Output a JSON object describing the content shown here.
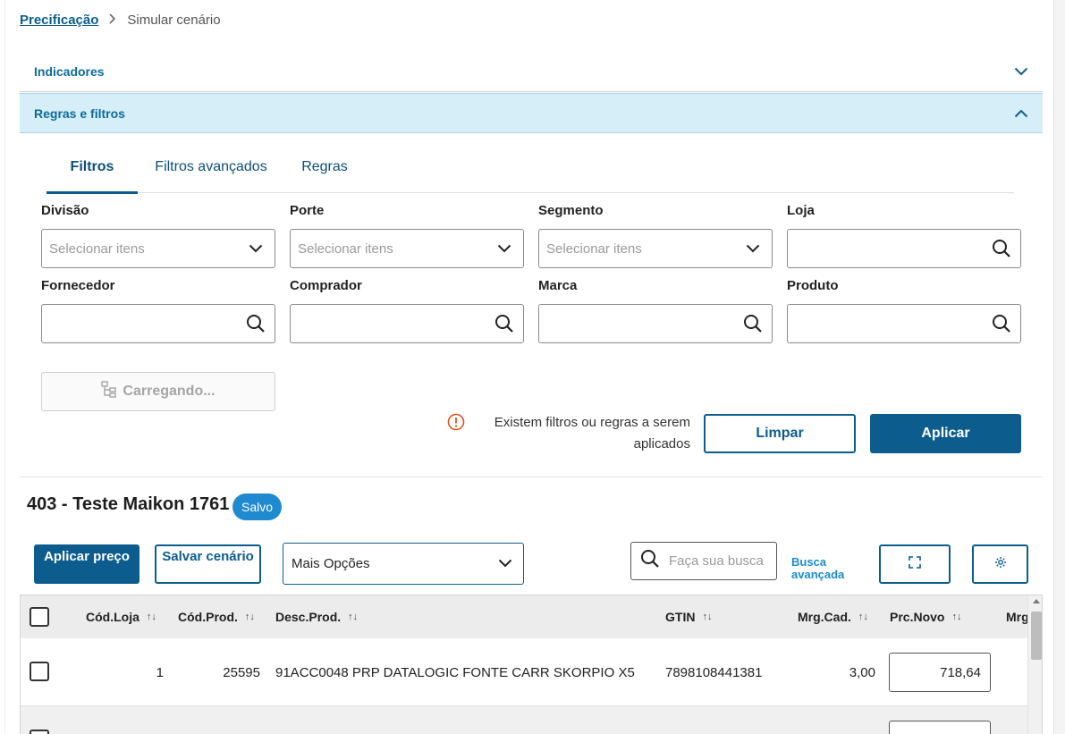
{
  "breadcrumb": {
    "root": "Precificação",
    "current": "Simular cenário"
  },
  "accordions": {
    "indicators": "Indicadores",
    "rules_filters": "Regras e filtros"
  },
  "tabs": [
    {
      "label": "Filtros"
    },
    {
      "label": "Filtros avançados"
    },
    {
      "label": "Regras"
    }
  ],
  "filters": {
    "divisao": {
      "label": "Divisão",
      "placeholder": "Selecionar itens"
    },
    "porte": {
      "label": "Porte",
      "placeholder": "Selecionar itens"
    },
    "segmento": {
      "label": "Segmento",
      "placeholder": "Selecionar itens"
    },
    "loja": {
      "label": "Loja"
    },
    "fornecedor": {
      "label": "Fornecedor"
    },
    "comprador": {
      "label": "Comprador"
    },
    "marca": {
      "label": "Marca"
    },
    "produto": {
      "label": "Produto"
    }
  },
  "loading_label": "Carregando...",
  "warning": {
    "text": "Existem filtros ou regras a serem aplicados"
  },
  "actions": {
    "clear": "Limpar",
    "apply": "Aplicar"
  },
  "scenario": {
    "title": "403 - Teste Maikon 1761",
    "status": "Salvo"
  },
  "toolbar": {
    "apply_price": "Aplicar preço",
    "save_scenario": "Salvar cenário",
    "more_options": "Mais Opções",
    "search_placeholder": "Faça sua busca",
    "advanced_search": "Busca avançada"
  },
  "table": {
    "columns": [
      "Cód.Loja",
      "Cód.Prod.",
      "Desc.Prod.",
      "GTIN",
      "Mrg.Cad.",
      "Prc.Novo",
      "Mrg"
    ],
    "rows": [
      {
        "cod_loja": "1",
        "cod_prod": "25595",
        "desc": "91ACC0048 PRP DATALOGIC FONTE CARR SKORPIO X5",
        "gtin": "7898108441381",
        "mrg_cad": "3,00",
        "prc_novo": "718,64"
      }
    ]
  },
  "colors": {
    "primary": "#0c5d8e",
    "accent": "#1a8ccc",
    "badge": "#1f8ad0",
    "warning": "#e0531f",
    "accordion_active": "#d6eef8"
  },
  "icons": [
    "chevron-right-icon",
    "chevron-down-icon",
    "chevron-up-icon",
    "search-icon",
    "tree-icon",
    "alert-circle-icon",
    "expand-icon",
    "gear-icon",
    "sort-icon"
  ]
}
